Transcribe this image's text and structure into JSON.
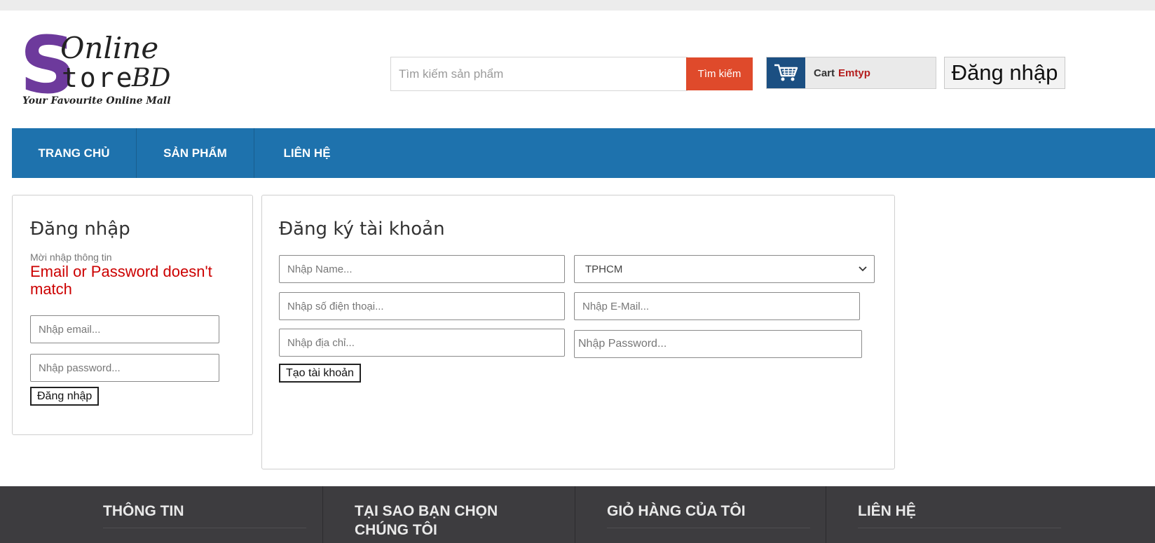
{
  "logo": {
    "initial": "S",
    "line1": "Online",
    "line2": "tore",
    "suffix": "BD",
    "tagline": "Your Favourite Online Mall"
  },
  "header": {
    "search_placeholder": "Tìm kiếm sản phẩm",
    "search_button": "Tìm kiếm",
    "cart_label": "Cart",
    "cart_status": "Emtyp",
    "login_button": "Đăng nhập"
  },
  "nav": {
    "items": [
      {
        "label": "TRANG CHỦ"
      },
      {
        "label": "SẢN PHẨM"
      },
      {
        "label": "LIÊN HỆ"
      }
    ]
  },
  "login_panel": {
    "title": "Đăng nhập",
    "hint": "Mời nhập thông tin",
    "error": "Email or Password doesn't match",
    "email_placeholder": "Nhập email...",
    "password_placeholder": "Nhập password...",
    "submit": "Đăng nhập"
  },
  "register_panel": {
    "title": "Đăng ký tài khoản",
    "name_placeholder": "Nhập Name...",
    "city_selected": "TPHCM",
    "phone_placeholder": "Nhập số điện thoại...",
    "email_placeholder": "Nhập E-Mail...",
    "address_placeholder": "Nhập địa chỉ...",
    "password_placeholder": "Nhập Password...",
    "submit": "Tạo tài khoản"
  },
  "footer": {
    "columns": [
      {
        "title": "THÔNG TIN"
      },
      {
        "title": "TẠI SAO BẠN CHỌN CHÚNG TÔI"
      },
      {
        "title": "GIỎ HÀNG CỦA TÔI"
      },
      {
        "title": "LIÊN HỆ"
      }
    ]
  },
  "colors": {
    "nav_bg": "#1e72ad",
    "search_button": "#df4a2b",
    "cart_icon_bg": "#1b4f82",
    "error_text": "#cc0000",
    "footer_bg": "#3d3c3f",
    "logo_purple": "#6d3a9c"
  },
  "icons": {
    "cart": "shopping-cart-icon",
    "dropdown": "chevron-down-icon"
  }
}
